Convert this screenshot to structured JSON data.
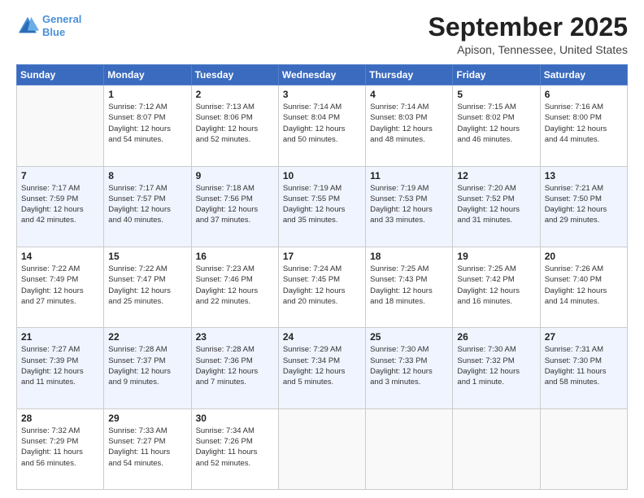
{
  "header": {
    "logo_line1": "General",
    "logo_line2": "Blue",
    "month_title": "September 2025",
    "location": "Apison, Tennessee, United States"
  },
  "days_of_week": [
    "Sunday",
    "Monday",
    "Tuesday",
    "Wednesday",
    "Thursday",
    "Friday",
    "Saturday"
  ],
  "weeks": [
    [
      {
        "day": null,
        "info": null
      },
      {
        "day": "1",
        "info": "Sunrise: 7:12 AM\nSunset: 8:07 PM\nDaylight: 12 hours\nand 54 minutes."
      },
      {
        "day": "2",
        "info": "Sunrise: 7:13 AM\nSunset: 8:06 PM\nDaylight: 12 hours\nand 52 minutes."
      },
      {
        "day": "3",
        "info": "Sunrise: 7:14 AM\nSunset: 8:04 PM\nDaylight: 12 hours\nand 50 minutes."
      },
      {
        "day": "4",
        "info": "Sunrise: 7:14 AM\nSunset: 8:03 PM\nDaylight: 12 hours\nand 48 minutes."
      },
      {
        "day": "5",
        "info": "Sunrise: 7:15 AM\nSunset: 8:02 PM\nDaylight: 12 hours\nand 46 minutes."
      },
      {
        "day": "6",
        "info": "Sunrise: 7:16 AM\nSunset: 8:00 PM\nDaylight: 12 hours\nand 44 minutes."
      }
    ],
    [
      {
        "day": "7",
        "info": "Sunrise: 7:17 AM\nSunset: 7:59 PM\nDaylight: 12 hours\nand 42 minutes."
      },
      {
        "day": "8",
        "info": "Sunrise: 7:17 AM\nSunset: 7:57 PM\nDaylight: 12 hours\nand 40 minutes."
      },
      {
        "day": "9",
        "info": "Sunrise: 7:18 AM\nSunset: 7:56 PM\nDaylight: 12 hours\nand 37 minutes."
      },
      {
        "day": "10",
        "info": "Sunrise: 7:19 AM\nSunset: 7:55 PM\nDaylight: 12 hours\nand 35 minutes."
      },
      {
        "day": "11",
        "info": "Sunrise: 7:19 AM\nSunset: 7:53 PM\nDaylight: 12 hours\nand 33 minutes."
      },
      {
        "day": "12",
        "info": "Sunrise: 7:20 AM\nSunset: 7:52 PM\nDaylight: 12 hours\nand 31 minutes."
      },
      {
        "day": "13",
        "info": "Sunrise: 7:21 AM\nSunset: 7:50 PM\nDaylight: 12 hours\nand 29 minutes."
      }
    ],
    [
      {
        "day": "14",
        "info": "Sunrise: 7:22 AM\nSunset: 7:49 PM\nDaylight: 12 hours\nand 27 minutes."
      },
      {
        "day": "15",
        "info": "Sunrise: 7:22 AM\nSunset: 7:47 PM\nDaylight: 12 hours\nand 25 minutes."
      },
      {
        "day": "16",
        "info": "Sunrise: 7:23 AM\nSunset: 7:46 PM\nDaylight: 12 hours\nand 22 minutes."
      },
      {
        "day": "17",
        "info": "Sunrise: 7:24 AM\nSunset: 7:45 PM\nDaylight: 12 hours\nand 20 minutes."
      },
      {
        "day": "18",
        "info": "Sunrise: 7:25 AM\nSunset: 7:43 PM\nDaylight: 12 hours\nand 18 minutes."
      },
      {
        "day": "19",
        "info": "Sunrise: 7:25 AM\nSunset: 7:42 PM\nDaylight: 12 hours\nand 16 minutes."
      },
      {
        "day": "20",
        "info": "Sunrise: 7:26 AM\nSunset: 7:40 PM\nDaylight: 12 hours\nand 14 minutes."
      }
    ],
    [
      {
        "day": "21",
        "info": "Sunrise: 7:27 AM\nSunset: 7:39 PM\nDaylight: 12 hours\nand 11 minutes."
      },
      {
        "day": "22",
        "info": "Sunrise: 7:28 AM\nSunset: 7:37 PM\nDaylight: 12 hours\nand 9 minutes."
      },
      {
        "day": "23",
        "info": "Sunrise: 7:28 AM\nSunset: 7:36 PM\nDaylight: 12 hours\nand 7 minutes."
      },
      {
        "day": "24",
        "info": "Sunrise: 7:29 AM\nSunset: 7:34 PM\nDaylight: 12 hours\nand 5 minutes."
      },
      {
        "day": "25",
        "info": "Sunrise: 7:30 AM\nSunset: 7:33 PM\nDaylight: 12 hours\nand 3 minutes."
      },
      {
        "day": "26",
        "info": "Sunrise: 7:30 AM\nSunset: 7:32 PM\nDaylight: 12 hours\nand 1 minute."
      },
      {
        "day": "27",
        "info": "Sunrise: 7:31 AM\nSunset: 7:30 PM\nDaylight: 11 hours\nand 58 minutes."
      }
    ],
    [
      {
        "day": "28",
        "info": "Sunrise: 7:32 AM\nSunset: 7:29 PM\nDaylight: 11 hours\nand 56 minutes."
      },
      {
        "day": "29",
        "info": "Sunrise: 7:33 AM\nSunset: 7:27 PM\nDaylight: 11 hours\nand 54 minutes."
      },
      {
        "day": "30",
        "info": "Sunrise: 7:34 AM\nSunset: 7:26 PM\nDaylight: 11 hours\nand 52 minutes."
      },
      {
        "day": null,
        "info": null
      },
      {
        "day": null,
        "info": null
      },
      {
        "day": null,
        "info": null
      },
      {
        "day": null,
        "info": null
      }
    ]
  ]
}
